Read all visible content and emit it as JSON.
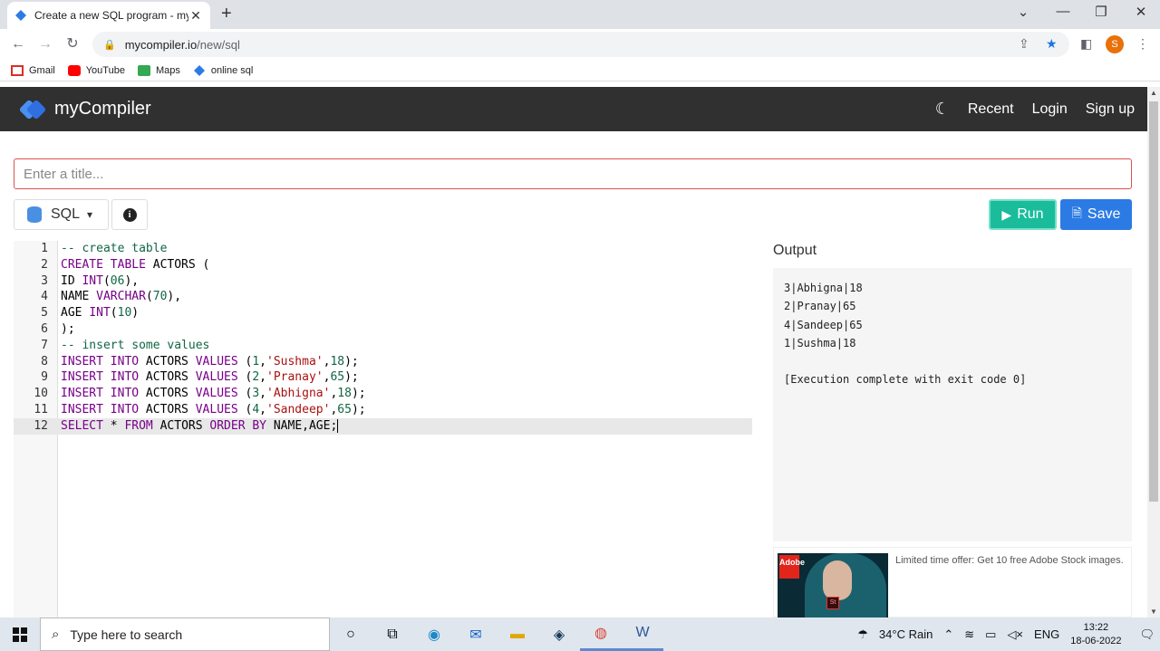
{
  "browser": {
    "tab_title": "Create a new SQL program - myC",
    "tab_close": "✕",
    "new_tab": "+",
    "window_controls": {
      "chevron": "⌄",
      "minimize": "—",
      "restore": "❐",
      "close": "✕"
    },
    "url_host": "mycompiler.io",
    "url_path": "/new/sql",
    "profile_initial": "S",
    "bookmarks": [
      {
        "label": "Gmail",
        "icon": "gmail-icon",
        "color": "#d93025"
      },
      {
        "label": "YouTube",
        "icon": "youtube-icon",
        "color": "#ff0000"
      },
      {
        "label": "Maps",
        "icon": "maps-icon",
        "color": "#34a853"
      },
      {
        "label": "online sql",
        "icon": "mycompiler-icon",
        "color": "#2c7be5"
      }
    ]
  },
  "site": {
    "brand": "myCompiler",
    "nav": {
      "recent": "Recent",
      "login": "Login",
      "signup": "Sign up"
    },
    "title_placeholder": "Enter a title...",
    "language": "SQL",
    "run_label": "Run",
    "save_label": "Save",
    "output_label": "Output",
    "colors": {
      "header_bg": "#303030",
      "run": "#1abc9c",
      "save": "#2c7be5",
      "title_border": "#d9534f"
    }
  },
  "editor": {
    "lines": [
      {
        "n": "1",
        "tokens": [
          {
            "t": "-- create table",
            "c": "cm"
          }
        ]
      },
      {
        "n": "2",
        "tokens": [
          {
            "t": "CREATE TABLE",
            "c": "kw"
          },
          {
            "t": " ACTORS (",
            "c": "plain"
          }
        ]
      },
      {
        "n": "3",
        "tokens": [
          {
            "t": "ID ",
            "c": "plain"
          },
          {
            "t": "INT",
            "c": "kw"
          },
          {
            "t": "(",
            "c": "plain"
          },
          {
            "t": "06",
            "c": "num"
          },
          {
            "t": "),",
            "c": "plain"
          }
        ]
      },
      {
        "n": "4",
        "tokens": [
          {
            "t": "NAME ",
            "c": "plain"
          },
          {
            "t": "VARCHAR",
            "c": "kw"
          },
          {
            "t": "(",
            "c": "plain"
          },
          {
            "t": "70",
            "c": "num"
          },
          {
            "t": "),",
            "c": "plain"
          }
        ]
      },
      {
        "n": "5",
        "tokens": [
          {
            "t": "AGE ",
            "c": "plain"
          },
          {
            "t": "INT",
            "c": "kw"
          },
          {
            "t": "(",
            "c": "plain"
          },
          {
            "t": "10",
            "c": "num"
          },
          {
            "t": ")",
            "c": "plain"
          }
        ]
      },
      {
        "n": "6",
        "tokens": [
          {
            "t": ");",
            "c": "plain"
          }
        ]
      },
      {
        "n": "7",
        "tokens": [
          {
            "t": "-- insert some values",
            "c": "cm"
          }
        ]
      },
      {
        "n": "8",
        "tokens": [
          {
            "t": "INSERT INTO",
            "c": "kw"
          },
          {
            "t": " ACTORS ",
            "c": "plain"
          },
          {
            "t": "VALUES",
            "c": "kw"
          },
          {
            "t": " (",
            "c": "plain"
          },
          {
            "t": "1",
            "c": "num"
          },
          {
            "t": ",",
            "c": "plain"
          },
          {
            "t": "'Sushma'",
            "c": "str"
          },
          {
            "t": ",",
            "c": "plain"
          },
          {
            "t": "18",
            "c": "num"
          },
          {
            "t": ");",
            "c": "plain"
          }
        ]
      },
      {
        "n": "9",
        "tokens": [
          {
            "t": "INSERT INTO",
            "c": "kw"
          },
          {
            "t": " ACTORS ",
            "c": "plain"
          },
          {
            "t": "VALUES",
            "c": "kw"
          },
          {
            "t": " (",
            "c": "plain"
          },
          {
            "t": "2",
            "c": "num"
          },
          {
            "t": ",",
            "c": "plain"
          },
          {
            "t": "'Pranay'",
            "c": "str"
          },
          {
            "t": ",",
            "c": "plain"
          },
          {
            "t": "65",
            "c": "num"
          },
          {
            "t": ");",
            "c": "plain"
          }
        ]
      },
      {
        "n": "10",
        "tokens": [
          {
            "t": "INSERT INTO",
            "c": "kw"
          },
          {
            "t": " ACTORS ",
            "c": "plain"
          },
          {
            "t": "VALUES",
            "c": "kw"
          },
          {
            "t": " (",
            "c": "plain"
          },
          {
            "t": "3",
            "c": "num"
          },
          {
            "t": ",",
            "c": "plain"
          },
          {
            "t": "'Abhigna'",
            "c": "str"
          },
          {
            "t": ",",
            "c": "plain"
          },
          {
            "t": "18",
            "c": "num"
          },
          {
            "t": ");",
            "c": "plain"
          }
        ]
      },
      {
        "n": "11",
        "tokens": [
          {
            "t": "INSERT INTO",
            "c": "kw"
          },
          {
            "t": " ACTORS ",
            "c": "plain"
          },
          {
            "t": "VALUES",
            "c": "kw"
          },
          {
            "t": " (",
            "c": "plain"
          },
          {
            "t": "4",
            "c": "num"
          },
          {
            "t": ",",
            "c": "plain"
          },
          {
            "t": "'Sandeep'",
            "c": "str"
          },
          {
            "t": ",",
            "c": "plain"
          },
          {
            "t": "65",
            "c": "num"
          },
          {
            "t": ");",
            "c": "plain"
          }
        ]
      },
      {
        "n": "12",
        "tokens": [
          {
            "t": "SELECT",
            "c": "kw"
          },
          {
            "t": " * ",
            "c": "plain"
          },
          {
            "t": "FROM",
            "c": "kw"
          },
          {
            "t": " ACTORS ",
            "c": "plain"
          },
          {
            "t": "ORDER BY",
            "c": "kw"
          },
          {
            "t": " NAME,AGE;",
            "c": "plain"
          }
        ]
      }
    ],
    "active_line": "12"
  },
  "output": {
    "rows": [
      "3|Abhigna|18",
      "2|Pranay|65",
      "4|Sandeep|65",
      "1|Sushma|18",
      "",
      "[Execution complete with exit code 0]"
    ]
  },
  "ad": {
    "text": "Limited time offer: Get 10 free Adobe Stock images.",
    "brand_badge": "Adobe",
    "product_badge": "St"
  },
  "taskbar": {
    "search_placeholder": "Type here to search",
    "weather": "34°C  Rain",
    "lang": "ENG",
    "time": "13:22",
    "date": "18-06-2022"
  }
}
